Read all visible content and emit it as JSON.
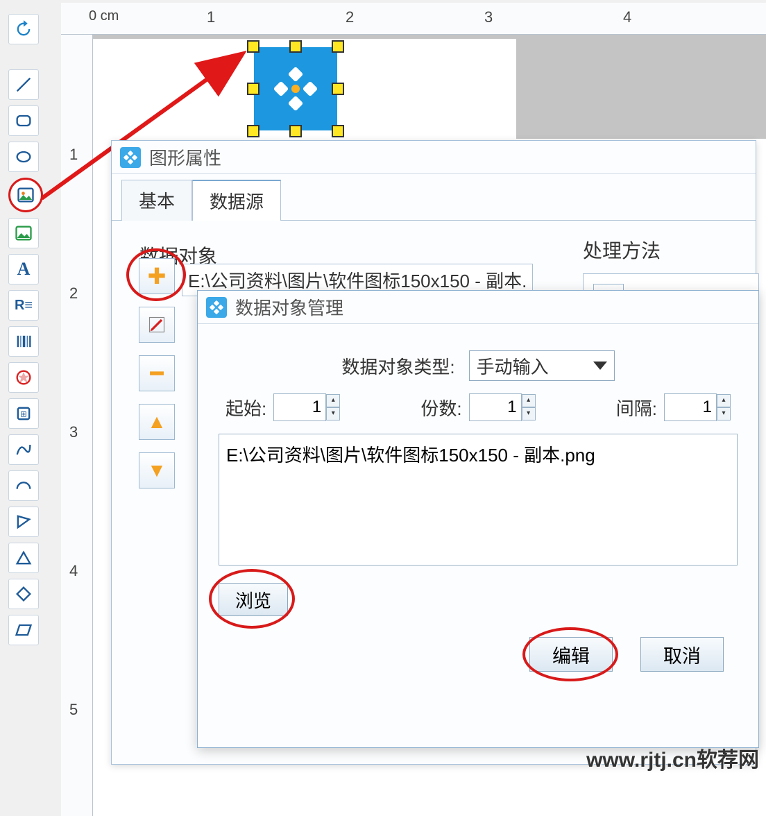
{
  "ruler": {
    "unit": "0 cm",
    "ticks_h": [
      "1",
      "2",
      "3",
      "4"
    ],
    "ticks_v": [
      "1",
      "2",
      "3",
      "4",
      "5"
    ]
  },
  "toolbar": {
    "items": [
      "refresh",
      "line",
      "rounded-rect",
      "ellipse",
      "image",
      "image-link",
      "text",
      "rich-text",
      "barcode",
      "shape-a",
      "shape-b",
      "curve",
      "arc",
      "polygon",
      "triangle",
      "diamond",
      "parallelogram"
    ]
  },
  "dialog1": {
    "title": "图形属性",
    "tabs": {
      "basic": "基本",
      "datasource": "数据源"
    },
    "section_data_object": "数据对象",
    "section_processing": "处理方法",
    "path_preview": "E:\\公司资料\\图片\\软件图标150x150 - 副本."
  },
  "dialog2": {
    "title": "数据对象管理",
    "type_label": "数据对象类型:",
    "type_value": "手动输入",
    "start_label": "起始:",
    "start_value": "1",
    "copies_label": "份数:",
    "copies_value": "1",
    "interval_label": "间隔:",
    "interval_value": "1",
    "content": "E:\\公司资料\\图片\\软件图标150x150 - 副本.png",
    "browse": "浏览",
    "edit": "编辑",
    "cancel": "取消"
  },
  "watermark": "www.rjtj.cn软荐网"
}
